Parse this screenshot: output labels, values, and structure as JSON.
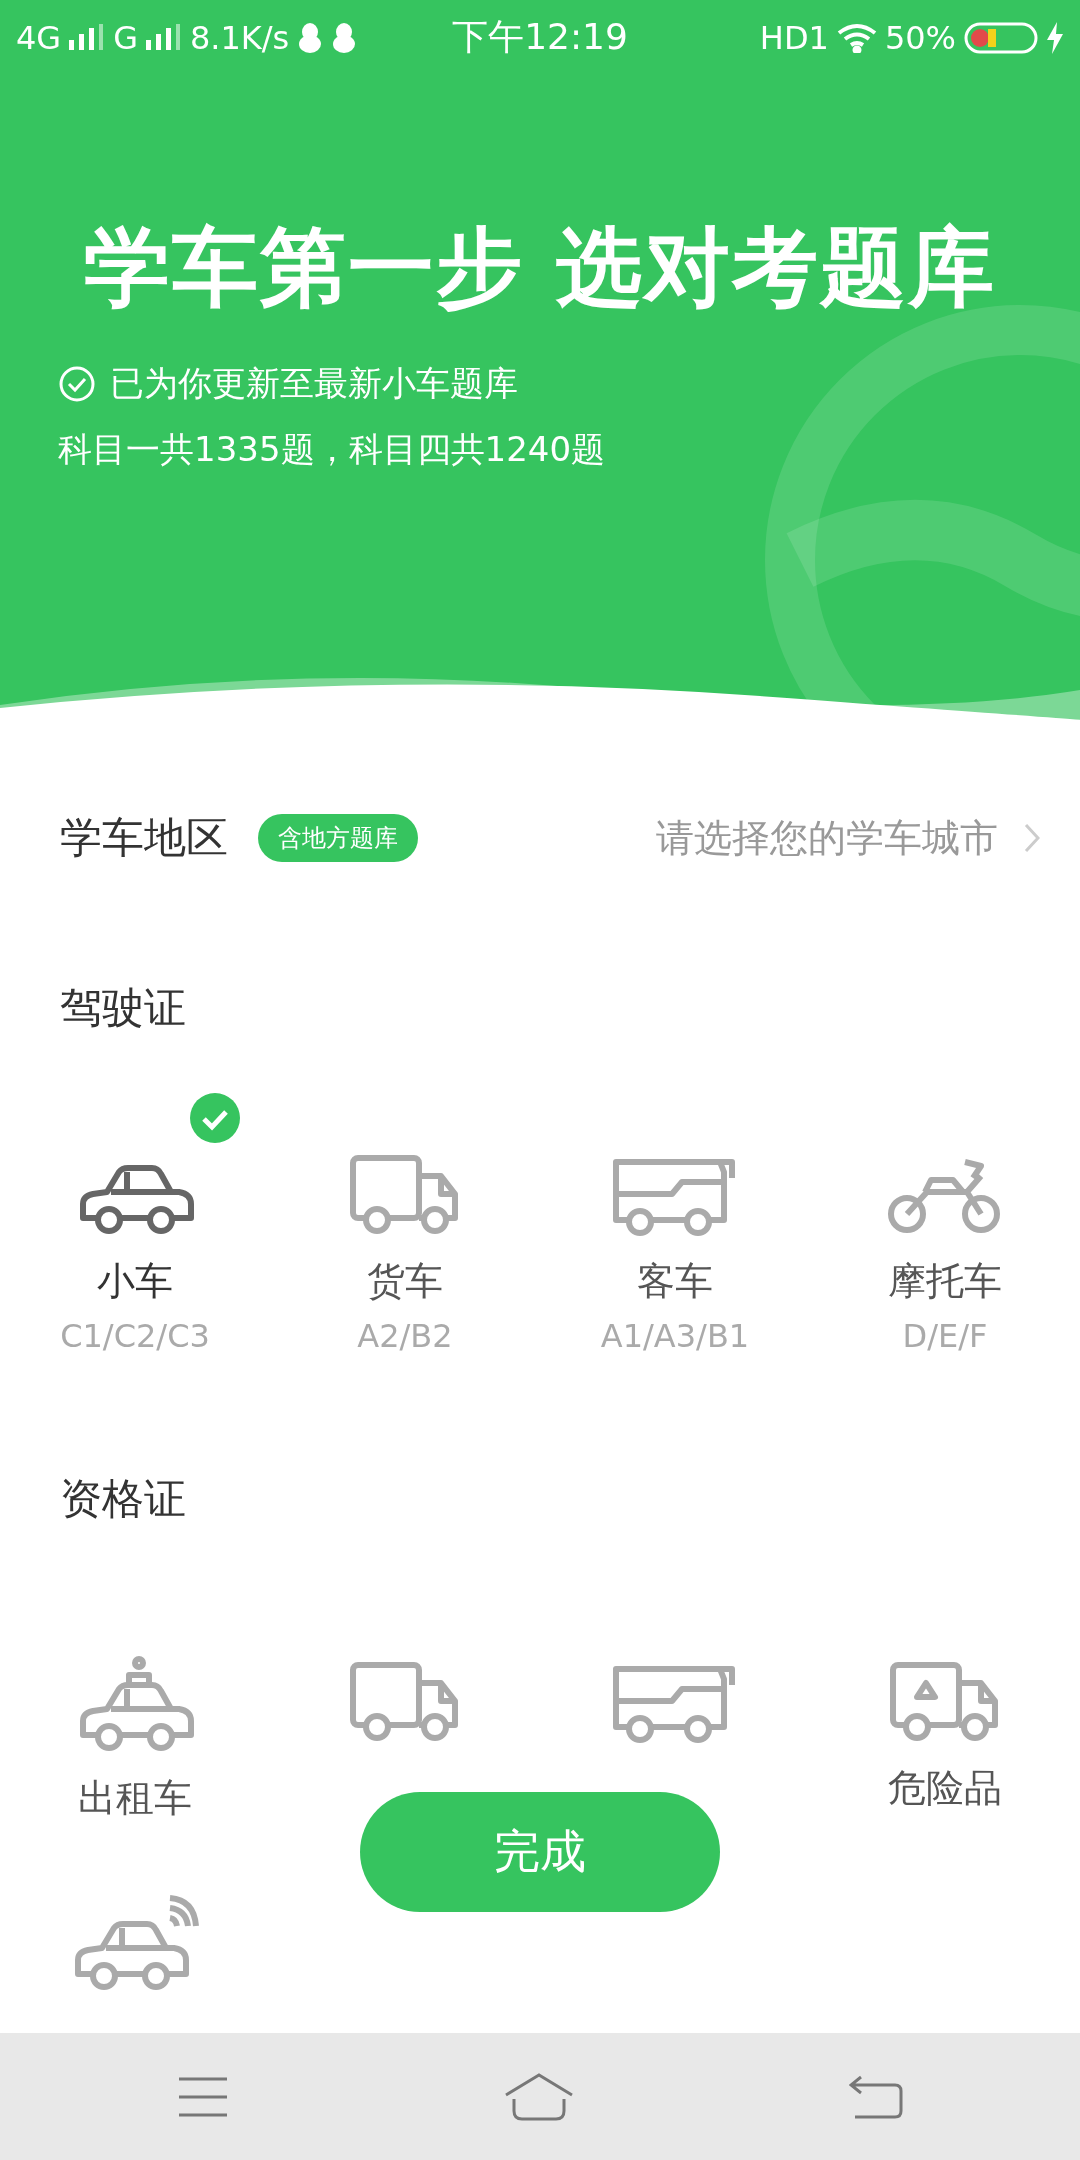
{
  "status_bar": {
    "network_1": "4G",
    "network_2": "G",
    "speed": "8.1K/s",
    "time": "下午12:19",
    "hd": "HD1",
    "battery": "50%"
  },
  "header": {
    "title": "学车第一步 选对考题库",
    "notice": "已为你更新至最新小车题库",
    "counts": "科目一共1335题，科目四共1240题"
  },
  "region": {
    "label": "学车地区",
    "badge": "含地方题库",
    "placeholder": "请选择您的学车城市"
  },
  "license": {
    "title": "驾驶证",
    "items": [
      {
        "label": "小车",
        "code": "C1/C2/C3",
        "selected": true
      },
      {
        "label": "货车",
        "code": "A2/B2",
        "selected": false
      },
      {
        "label": "客车",
        "code": "A1/A3/B1",
        "selected": false
      },
      {
        "label": "摩托车",
        "code": "D/E/F",
        "selected": false
      }
    ]
  },
  "qualification": {
    "title": "资格证",
    "items": [
      {
        "kind": "labeled",
        "label": "出租车"
      },
      {
        "kind": "covered"
      },
      {
        "kind": "covered"
      },
      {
        "kind": "labeled",
        "label": "危险品"
      },
      {
        "kind": "covered"
      }
    ]
  },
  "done_button": "完成"
}
